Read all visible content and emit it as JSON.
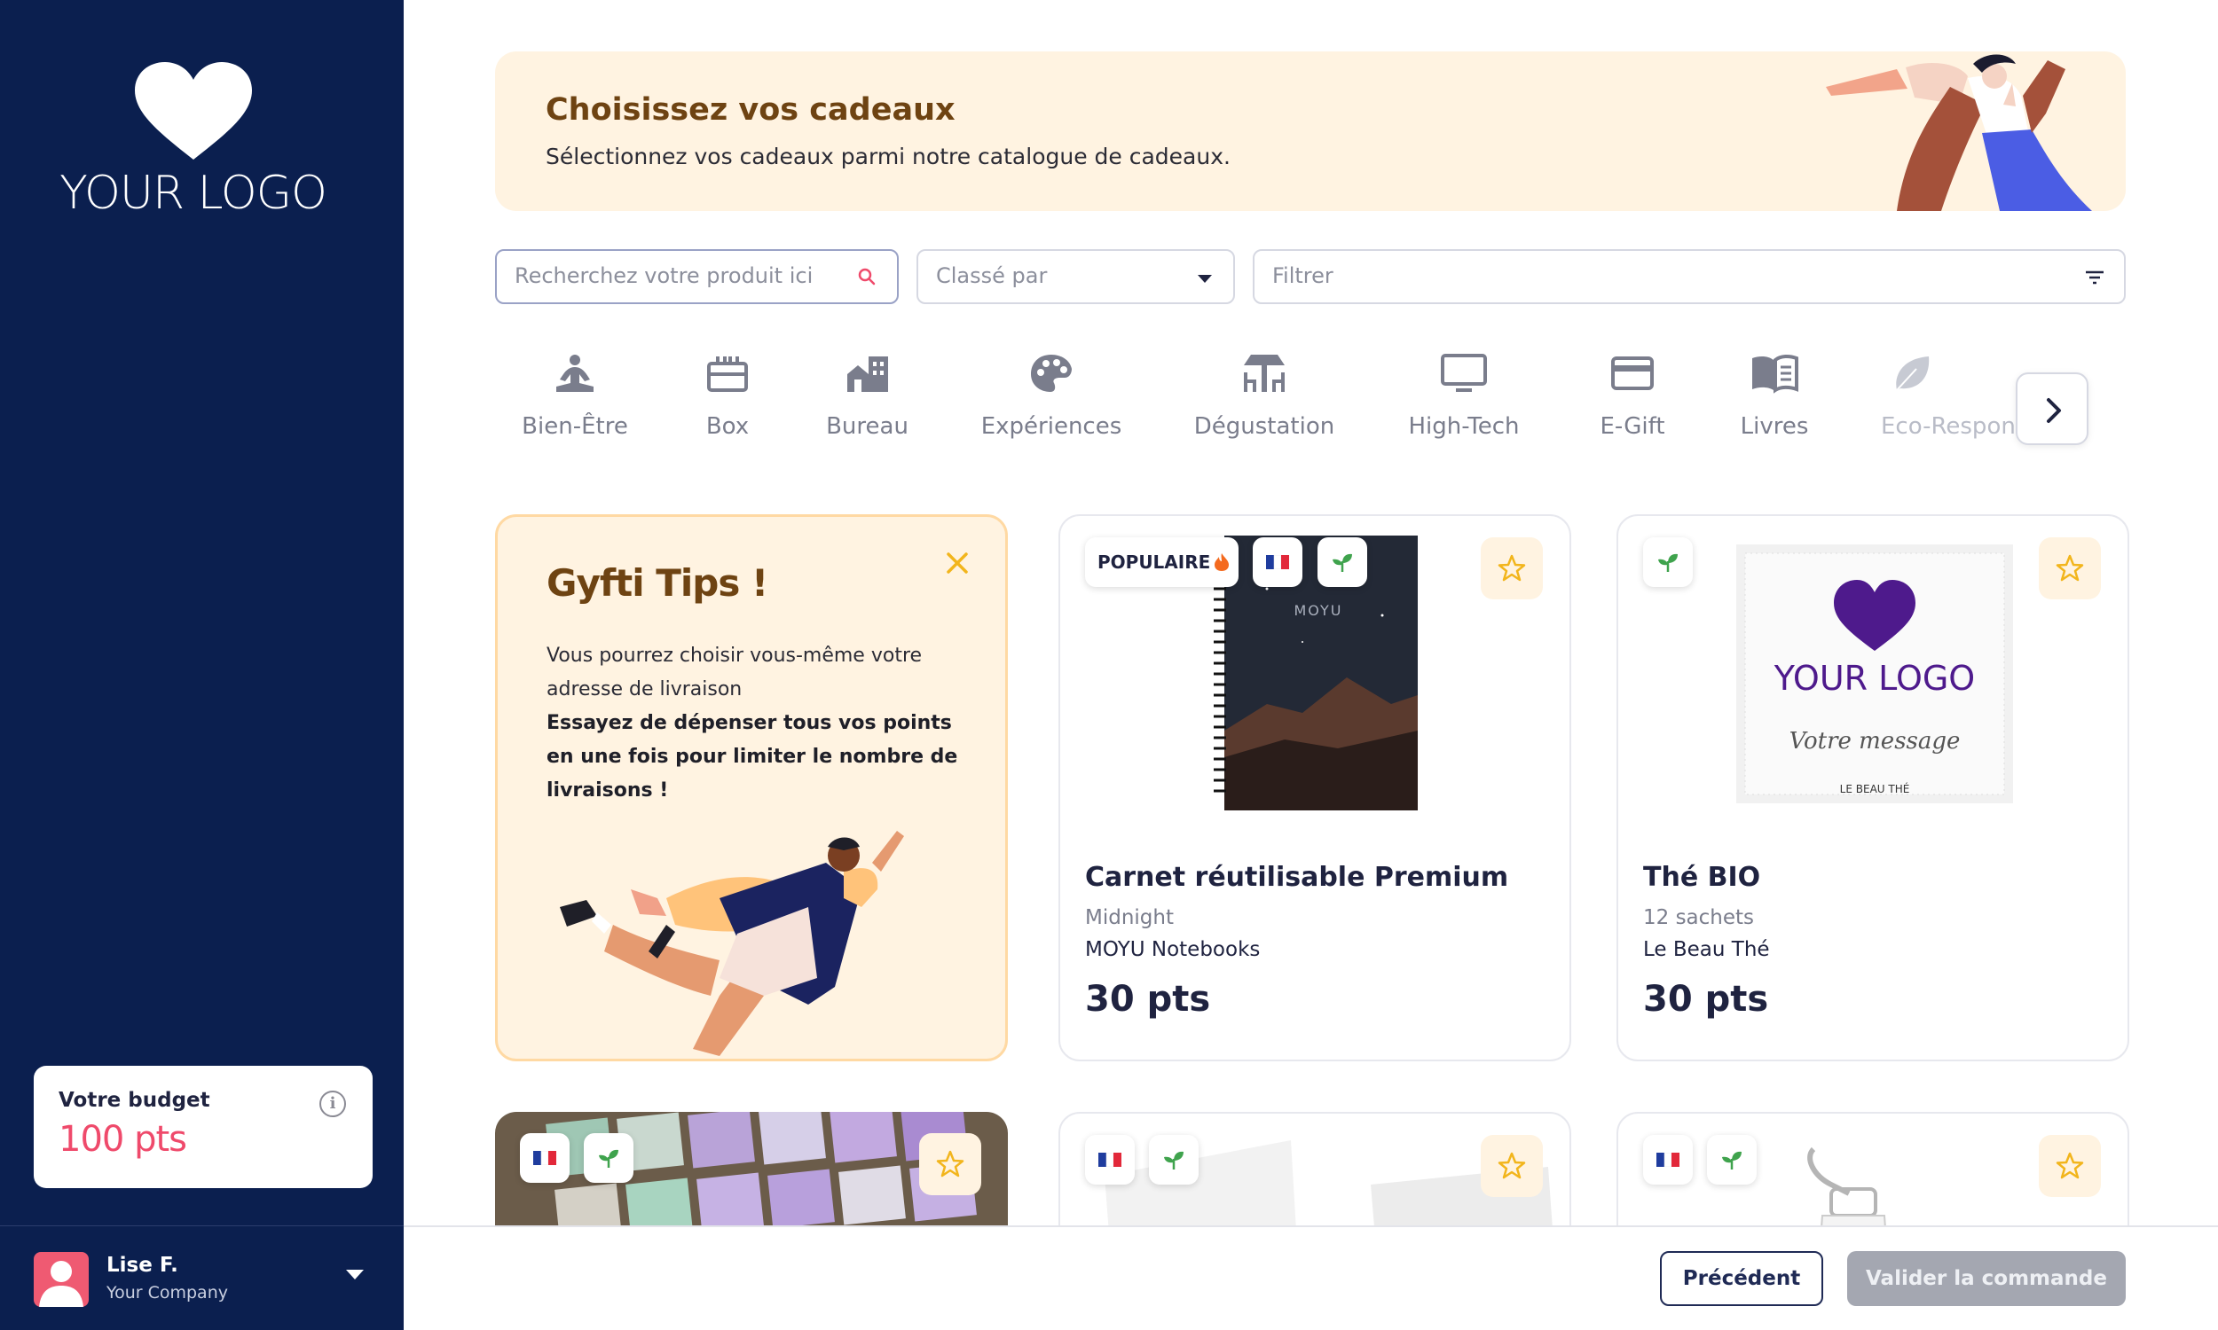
{
  "sidebar": {
    "logo_text": "YOUR LOGO",
    "logo_icon": "heart-icon",
    "budget": {
      "title": "Votre budget",
      "value": "100 pts"
    },
    "user": {
      "name": "Lise F.",
      "company": "Your Company"
    }
  },
  "banner": {
    "title": "Choisissez vos cadeaux",
    "subtitle": "Sélectionnez vos cadeaux parmi notre catalogue de cadeaux."
  },
  "controls": {
    "search_placeholder": "Recherchez votre produit ici",
    "sort_label": "Classé par",
    "filter_label": "Filtrer"
  },
  "categories": [
    {
      "label": "Bien-Être",
      "icon": "meditation-icon"
    },
    {
      "label": "Box",
      "icon": "gift-box-icon"
    },
    {
      "label": "Bureau",
      "icon": "office-building-icon"
    },
    {
      "label": "Expériences",
      "icon": "palette-icon"
    },
    {
      "label": "Dégustation",
      "icon": "dining-table-icon"
    },
    {
      "label": "High-Tech",
      "icon": "monitor-icon"
    },
    {
      "label": "E-Gift",
      "icon": "credit-card-icon"
    },
    {
      "label": "Livres",
      "icon": "book-icon"
    },
    {
      "label": "Eco-Responsable",
      "icon": "leaf-icon"
    }
  ],
  "tips": {
    "title": "Gyfti Tips !",
    "line1": "Vous pourrez choisir vous-même votre adresse de livraison",
    "line2": "Essayez de dépenser tous vos points en une fois pour limiter le nombre de livraisons !"
  },
  "products": [
    {
      "name": "Carnet réutilisable Premium",
      "variant": "Midnight",
      "brand": "MOYU Notebooks",
      "price": "30 pts",
      "badge": "POPULAIRE",
      "flags": [
        "french-flag-icon",
        "eco-sprout-icon"
      ],
      "image_text": "MOYU"
    },
    {
      "name": "Thé BIO",
      "variant": "12 sachets",
      "brand": "Le Beau Thé",
      "price": "30 pts",
      "flags": [
        "eco-sprout-icon"
      ],
      "image_logo": "YOUR LOGO",
      "image_message": "Votre message",
      "image_brand": "LE BEAU THÉ"
    }
  ],
  "footer": {
    "previous": "Précédent",
    "validate": "Valider la commande"
  },
  "colors": {
    "sidebar": "#0b1f4f",
    "accent_pink": "#ef4a6b",
    "banner_bg": "#fff3e1",
    "banner_title": "#6e4312",
    "tag_star": "#f2b51c",
    "sprout": "#3fa34d"
  }
}
